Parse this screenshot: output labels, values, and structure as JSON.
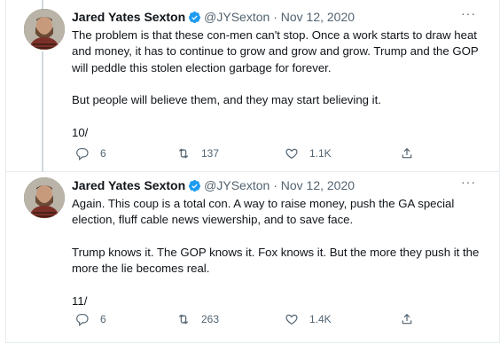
{
  "tweets": [
    {
      "author_name": "Jared Yates Sexton",
      "handle": "@JYSexton",
      "separator": "·",
      "date": "Nov 12, 2020",
      "more": "···",
      "paragraphs": [
        "The problem is that these con-men can't stop. Once a work starts to draw heat and money, it has to continue to grow and grow and grow. Trump and the GOP will peddle this stolen election garbage for forever.",
        "But people will believe them, and they may start believing it.",
        "10/"
      ],
      "replies": "6",
      "retweets": "137",
      "likes": "1.1K"
    },
    {
      "author_name": "Jared Yates Sexton",
      "handle": "@JYSexton",
      "separator": "·",
      "date": "Nov 12, 2020",
      "more": "···",
      "paragraphs": [
        "Again. This coup is a total con. A way to raise money, push the GA special election, fluff cable news viewership, and to save face.",
        "Trump knows it. The GOP knows it. Fox knows it. But the more they push it the more the lie becomes real.",
        "11/"
      ],
      "replies": "6",
      "retweets": "263",
      "likes": "1.4K"
    }
  ],
  "colors": {
    "verified": "#1d9bf0",
    "muted": "#536471",
    "text": "#0f1419",
    "thread_line": "#cfd9de"
  },
  "icons": [
    "reply-icon",
    "retweet-icon",
    "like-icon",
    "share-icon",
    "verified-badge-icon",
    "more-icon"
  ]
}
